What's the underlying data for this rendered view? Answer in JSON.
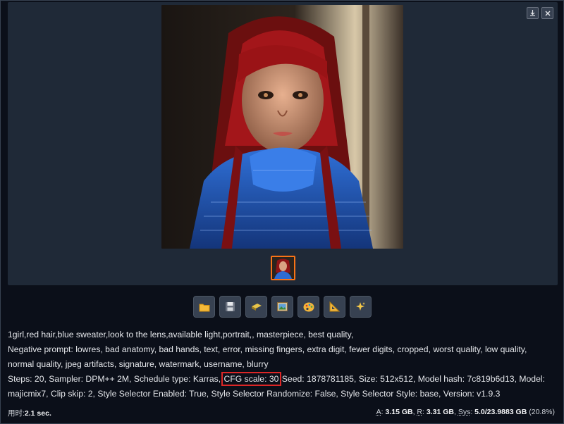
{
  "gallery": {
    "download_icon": "download-icon",
    "close_icon": "close-icon"
  },
  "toolbar": {
    "buttons": [
      {
        "name": "open-folder-button",
        "icon": "folder-icon",
        "glyph": "📁"
      },
      {
        "name": "save-button",
        "icon": "floppy-disk-icon",
        "glyph": "💾"
      },
      {
        "name": "zip-button",
        "icon": "package-icon",
        "glyph": "🗜"
      },
      {
        "name": "send-to-img2img-button",
        "icon": "picture-icon",
        "glyph": "🖼"
      },
      {
        "name": "send-to-inpaint-button",
        "icon": "palette-icon",
        "glyph": "🎨"
      },
      {
        "name": "send-to-extras-button",
        "icon": "triangle-ruler-icon",
        "glyph": "📐"
      },
      {
        "name": "send-to-extensions-button",
        "icon": "sparkle-icon",
        "glyph": "✨"
      }
    ]
  },
  "info": {
    "prompt": "1girl,red hair,blue sweater,look to the lens,available light,portrait,, masterpiece, best quality,",
    "negative_prompt": "Negative prompt: lowres, bad anatomy, bad hands, text, error, missing fingers, extra digit, fewer digits, cropped, worst quality, low quality, normal quality, jpeg artifacts, signature, watermark, username, blurry",
    "params_before": "Steps: 20, Sampler: DPM++ 2M, Schedule type: Karras, ",
    "params_cfg": "CFG scale: 30",
    "params_after": " Seed: 1878781185, Size: 512x512, Model hash: 7c819b6d13, Model: majicmix7, Clip skip: 2, Style Selector Enabled: True, Style Selector Randomize: False, Style Selector Style: base, Version: v1.9.3"
  },
  "footer": {
    "time_label": "用时:",
    "time_value": "2.1 sec.",
    "a_label": "A",
    "a_value": "3.15 GB",
    "r_label": "R",
    "r_value": "3.31 GB",
    "sys_label": "Sys",
    "sys_value": "5.0/23.9883 GB",
    "sys_pct": "(20.8%)"
  }
}
